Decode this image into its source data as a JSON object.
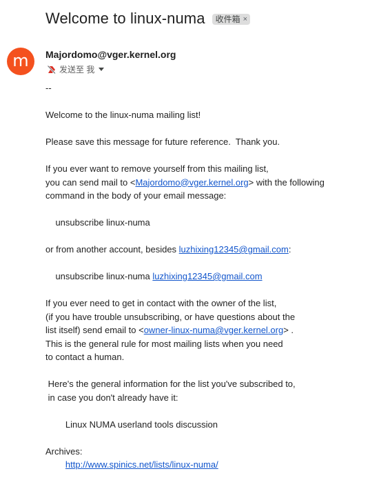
{
  "subject": "Welcome to linux-numa",
  "label": {
    "text": "收件箱",
    "close": "×"
  },
  "avatar": {
    "letter": "m",
    "color": "#f4511e"
  },
  "sender": {
    "name": "Majordomo@vger.kernel.org"
  },
  "recipient": {
    "text": "发送至 我",
    "icon": "important-marker-off-icon",
    "dropdown_icon": "caret-down-icon"
  },
  "body": {
    "line_sig": "--",
    "welcome": "Welcome to the linux-numa mailing list!",
    "save_msg": "Please save this message for future reference.  Thank you.",
    "remove_1": "If you ever want to remove yourself from this mailing list,",
    "remove_2_pre": "you can send mail to <",
    "remove_2_link": "Majordomo@vger.kernel.org",
    "remove_2_post": "> with the following",
    "remove_3": "command in the body of your email message:",
    "unsub_cmd": "    unsubscribe linux-numa",
    "other_pre": "or from another account, besides ",
    "other_link": "luzhixing12345@gmail.com",
    "other_post": ":",
    "unsub2_pre": "    unsubscribe linux-numa ",
    "unsub2_link": "luzhixing12345@gmail.com",
    "contact_1": "If you ever need to get in contact with the owner of the list,",
    "contact_2": "(if you have trouble unsubscribing, or have questions about the",
    "contact_3_pre": "list itself) send email to <",
    "contact_3_link": "owner-linux-numa@vger.kernel.org",
    "contact_3_post": "> .",
    "contact_4": "This is the general rule for most mailing lists when you need",
    "contact_5": "to contact a human.",
    "info_1": " Here's the general information for the list you've subscribed to,",
    "info_2": " in case you don't already have it:",
    "description": "        Linux NUMA userland tools discussion",
    "archives_label": "Archives:",
    "archives_indent": "        ",
    "archives_link": "http://www.spinics.net/lists/linux-numa/"
  }
}
